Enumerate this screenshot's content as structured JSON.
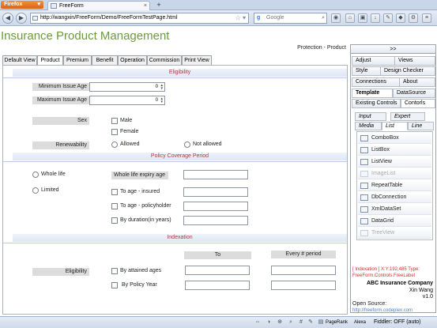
{
  "browser": {
    "menu_button": "Firefox",
    "tab_title": "FreeForm",
    "new_tab": "+",
    "url": "http://wangxin/FreeForm/Demo/FreeFormTestPage.html",
    "search_placeholder": "Google",
    "status_right": "Fiddler: OFF (auto)",
    "status_items": [
      "PageRank",
      "Alexa"
    ]
  },
  "page": {
    "title": "Insurance Product Management",
    "breadcrumb": "Protection - Product",
    "tabs": [
      "Default View",
      "Product",
      "Premium",
      "Benefit",
      "Operation",
      "Commission",
      "Print View"
    ],
    "active_tab": "Product"
  },
  "form": {
    "eligibility_section": "Eligibility",
    "min_issue_age_label": "Minimum Issue Age",
    "min_issue_age_value": "0",
    "max_issue_age_label": "Maximum Issue Age",
    "max_issue_age_value": "0",
    "sex_label": "Sex",
    "sex_options": [
      "Male",
      "Female"
    ],
    "renewability_label": "Renewability",
    "renewability_options": [
      "Allowed",
      "Not allowed"
    ],
    "coverage_section": "Policy Coverage Period",
    "coverage_options": [
      "Whole life",
      "Limited"
    ],
    "whole_life_expiry_label": "Whole life expiry age",
    "limited_options": [
      "To age - insured",
      "To age - policyholder",
      "By duration(in years)"
    ],
    "indexation_section": "Indexation",
    "col_to": "To",
    "col_every": "Every # period",
    "idx_eligibility_label": "Eligibility",
    "idx_options": [
      "By attained ages",
      "By Policy Year"
    ]
  },
  "panel": {
    "collapse": ">>",
    "menu_row1": [
      "Adjust",
      "Views"
    ],
    "menu_row2": [
      "Style",
      "Design Checker"
    ],
    "menu_row3": [
      "Connections",
      "About"
    ],
    "menu_row4": [
      "Template",
      "DataSource"
    ],
    "menu_row5": [
      "Existing Controls",
      "Contorls"
    ],
    "subtabs_row1": [
      "Input",
      "Expert"
    ],
    "subtabs_row2": [
      "Media",
      "List",
      "Line"
    ],
    "controls": [
      "ComboBox",
      "ListBox",
      "ListView",
      "ImageList",
      "RepeatTable",
      "DbConnection",
      "XmlDataSet",
      "DataGrid",
      "TreeView"
    ],
    "disabled_controls": [
      "ImageList",
      "TreeView"
    ],
    "info_line1": "[ Indexation ] X:Y:192,485 Type:",
    "info_line2": "FreeForm.Controls.FreeLabel",
    "company": "ABC Insurance Company",
    "author": "Xin Wang",
    "version": "v1.0",
    "open_source_label": "Open Source:",
    "open_source_link": "http://freeform.codeplex.com"
  },
  "colors": {
    "title_green": "#6e9a3c",
    "section_red": "#a33d3d",
    "info_red": "#d03030",
    "link_blue": "#4a7cc7"
  }
}
